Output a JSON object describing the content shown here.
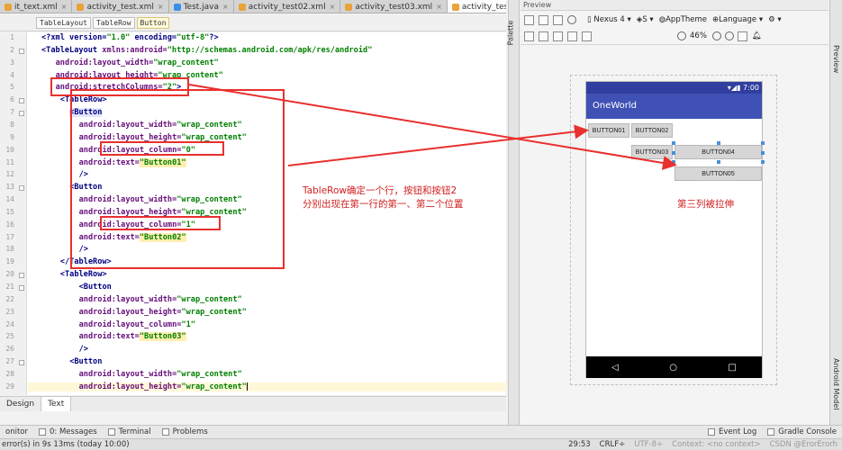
{
  "editor_tabs": [
    {
      "label": "it_text.xml",
      "active": false,
      "color": "#e8a33a"
    },
    {
      "label": "activity_test.xml",
      "active": false,
      "color": "#e8a33a"
    },
    {
      "label": "Test.java",
      "active": false,
      "color": "#3a8ee8"
    },
    {
      "label": "activity_test02.xml",
      "active": false,
      "color": "#e8a33a"
    },
    {
      "label": "activity_test03.xml",
      "active": false,
      "color": "#e8a33a"
    },
    {
      "label": "activity_test04.xml",
      "active": true,
      "color": "#e8a33a"
    }
  ],
  "breadcrumb": [
    "TableLayout",
    "TableRow",
    "Button"
  ],
  "code_lines": [
    {
      "n": "1",
      "html": "<span class='tg'>&lt;?xml version=</span><span class='vl'>\"1.0\"</span> <span class='tg'>encoding=</span><span class='vl'>\"utf-8\"</span><span class='tg'>?&gt;</span>",
      "indent": 0
    },
    {
      "n": "2",
      "html": "<span class='tg'>&lt;TableLayout</span> <span class='at'>xmlns:android=</span><span class='vl'>\"http://schemas.android.com/apk/res/android\"</span>",
      "indent": 0
    },
    {
      "n": "3",
      "html": "<span class='at'>android:layout_width=</span><span class='vl'>\"wrap_content\"</span>",
      "indent": 3
    },
    {
      "n": "4",
      "html": "<span class='at'>android:layout_height=</span><span class='vl'>\"wrap_content\"</span>",
      "indent": 3
    },
    {
      "n": "5",
      "html": "<span class='at'>android:stretchColumns=</span><span class='vl'>\"2\"</span><span class='tg'>&gt;</span>",
      "indent": 3
    },
    {
      "n": "6",
      "html": "<span class='tg'>&lt;TableRow&gt;</span>",
      "indent": 4
    },
    {
      "n": "7",
      "html": "<span class='tg hi-tag'>&lt;Button</span>",
      "indent": 6
    },
    {
      "n": "8",
      "html": "<span class='at'>android:layout_width=</span><span class='vl'>\"wrap_content\"</span>",
      "indent": 8
    },
    {
      "n": "9",
      "html": "<span class='at'>android:layout_height=</span><span class='vl'>\"wrap_content\"</span>",
      "indent": 8
    },
    {
      "n": "10",
      "html": "<span class='at'>android:layout_column=</span><span class='vl'>\"0\"</span>",
      "indent": 8
    },
    {
      "n": "11",
      "html": "<span class='at'>android:text=</span><span class='vl hl'>\"Button01\"</span>",
      "indent": 8
    },
    {
      "n": "12",
      "html": "<span class='tg'>/&gt;</span>",
      "indent": 8
    },
    {
      "n": "13",
      "html": "<span class='tg'>&lt;Button</span>",
      "indent": 6
    },
    {
      "n": "14",
      "html": "<span class='at'>android:layout_width=</span><span class='vl'>\"wrap_content\"</span>",
      "indent": 8
    },
    {
      "n": "15",
      "html": "<span class='at'>android:layout_height=</span><span class='vl'>\"wrap_content\"</span>",
      "indent": 8
    },
    {
      "n": "16",
      "html": "<span class='at'>android:layout_column=</span><span class='vl'>\"1\"</span>",
      "indent": 8
    },
    {
      "n": "17",
      "html": "<span class='at'>android:text=</span><span class='vl hl'>\"Button02\"</span>",
      "indent": 8
    },
    {
      "n": "18",
      "html": "<span class='tg'>/&gt;</span>",
      "indent": 8
    },
    {
      "n": "19",
      "html": "<span class='tg'>&lt;/TableRow&gt;</span>",
      "indent": 4
    },
    {
      "n": "20",
      "html": "<span class='tg'>&lt;TableRow&gt;</span>",
      "indent": 4
    },
    {
      "n": "21",
      "html": "<span class='tg'>&lt;Button</span>",
      "indent": 8
    },
    {
      "n": "22",
      "html": "<span class='at'>android:layout_width=</span><span class='vl'>\"wrap_content\"</span>",
      "indent": 8
    },
    {
      "n": "23",
      "html": "<span class='at'>android:layout_height=</span><span class='vl'>\"wrap_content\"</span>",
      "indent": 8
    },
    {
      "n": "24",
      "html": "<span class='at'>android:layout_column=</span><span class='vl'>\"1\"</span>",
      "indent": 8
    },
    {
      "n": "25",
      "html": "<span class='at'>android:text=</span><span class='vl hl'>\"Button03\"</span>",
      "indent": 8
    },
    {
      "n": "26",
      "html": "<span class='tg'>/&gt;</span>",
      "indent": 8
    },
    {
      "n": "27",
      "html": "<span class='tg'>&lt;Button</span>",
      "indent": 6
    },
    {
      "n": "28",
      "html": "<span class='at'>android:layout_width=</span><span class='vl'>\"wrap_content\"</span>",
      "indent": 8
    },
    {
      "n": "29",
      "html": "<span class='at'>android:layout_height=</span><span class='vl'>\"wrap_content\"</span><span class='caret'></span>",
      "indent": 8,
      "current": true
    }
  ],
  "annotation_left": [
    "TableRow确定一个行，按钮和按钮2",
    "分别出现在第一行的第一、第二个位置"
  ],
  "annotation_right": "第三列被拉伸",
  "view_tabs": [
    "Design",
    "Text"
  ],
  "tool_windows": [
    {
      "label": "onitor"
    },
    {
      "label": "0: Messages"
    },
    {
      "label": "Terminal"
    },
    {
      "label": "Problems"
    }
  ],
  "tool_windows_right": [
    {
      "label": "Event Log"
    },
    {
      "label": "Gradle Console"
    }
  ],
  "status": {
    "message": "error(s) in 9s 13ms (today 10:00)",
    "position": "29:53",
    "line_sep": "CRLF÷",
    "encoding": "UTF-8÷",
    "context": "Context: <no context>",
    "watermark": "CSDN @ErorErorh"
  },
  "palette_label": "Palette",
  "preview": {
    "header": "Preview",
    "device": "Nexus 4",
    "api": "S",
    "theme": "AppTheme",
    "language": "Language",
    "zoom": "46%"
  },
  "android": {
    "time": "7:00",
    "app_title": "OneWorld",
    "buttons": [
      "BUTTON01",
      "BUTTON02",
      "BUTTON03",
      "BUTTON04",
      "BUTTON05"
    ]
  },
  "right_labels": [
    "Preview",
    "Android Model"
  ],
  "colors": {
    "annotation": "#e8302e",
    "appbar": "#3f51b5",
    "statusbar": "#303f9f"
  }
}
